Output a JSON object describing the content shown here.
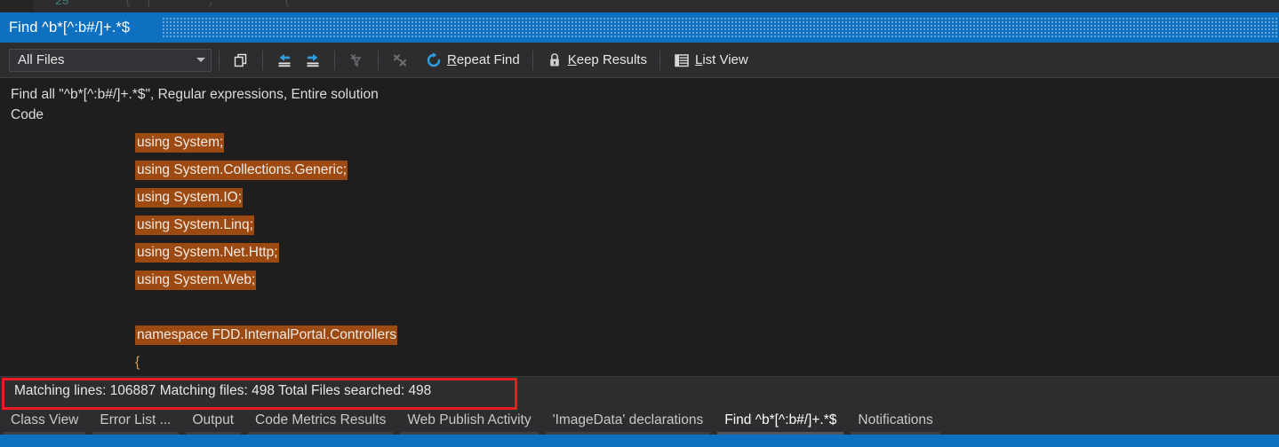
{
  "window": {
    "title": "Find ^b*[^:b#/]+.*$",
    "accent_blue": "#0e70c0",
    "highlight_orange": "#9c4a11",
    "annotation_red": "#e81d1d"
  },
  "top_strip": {
    "ghost_code_1": "25",
    "ghost_code_2": "{  |        ;          ("
  },
  "toolbar": {
    "scope_combo": {
      "value": "All Files",
      "icon": "chevron-down-icon"
    },
    "copy_button": {
      "label": "",
      "icon": "copy-icon",
      "tooltip": "Copy",
      "disabled": false
    },
    "prev_button": {
      "label": "",
      "icon": "previous-location-icon",
      "disabled": false
    },
    "next_button": {
      "label": "",
      "icon": "next-location-icon",
      "disabled": false
    },
    "clear_filter_button": {
      "label": "",
      "icon": "clear-filter-icon",
      "disabled": true
    },
    "clear_results_button": {
      "label": "",
      "icon": "clear-results-icon",
      "disabled": true
    },
    "repeat_find": {
      "label_pre": "",
      "accel": "R",
      "label_post": "epeat Find",
      "icon": "repeat-find-icon"
    },
    "keep_results": {
      "label_pre": "",
      "accel": "K",
      "label_post": "eep Results",
      "icon": "lock-icon"
    },
    "list_view": {
      "label_pre": "",
      "accel": "L",
      "label_post": "ist View",
      "icon": "list-view-icon"
    }
  },
  "summary": {
    "find_description": "Find all \"^b*[^:b#/]+.*$\", Regular expressions, Entire solution",
    "section_label": "Code"
  },
  "results": [
    {
      "match": "using System;",
      "trail": ""
    },
    {
      "match": "using System.Collections.Generic;",
      "trail": ""
    },
    {
      "match": "using System.IO;",
      "trail": ""
    },
    {
      "match": "using System.Linq;",
      "trail": ""
    },
    {
      "match": "using System.Net.Http;",
      "trail": ""
    },
    {
      "match": "using System.Web;",
      "trail": ""
    },
    {
      "match": "",
      "trail": ""
    },
    {
      "match": "namespace FDD.InternalPortal.Controllers",
      "trail": ""
    },
    {
      "match": "",
      "trail": "{"
    }
  ],
  "status": {
    "text": "Matching lines: 106887 Matching files: 498 Total Files searched: 498",
    "matching_lines": "106887",
    "matching_files": "498",
    "total_files_searched": "498"
  },
  "bottom_tabs": [
    {
      "label": "Class View",
      "selected": false
    },
    {
      "label": "Error List ...",
      "selected": false
    },
    {
      "label": "Output",
      "selected": false
    },
    {
      "label": "Code Metrics Results",
      "selected": false
    },
    {
      "label": "Web Publish Activity",
      "selected": false
    },
    {
      "label": "'ImageData' declarations",
      "selected": false
    },
    {
      "label": "Find ^b*[^:b#/]+.*$",
      "selected": true
    },
    {
      "label": "Notifications",
      "selected": false
    }
  ]
}
